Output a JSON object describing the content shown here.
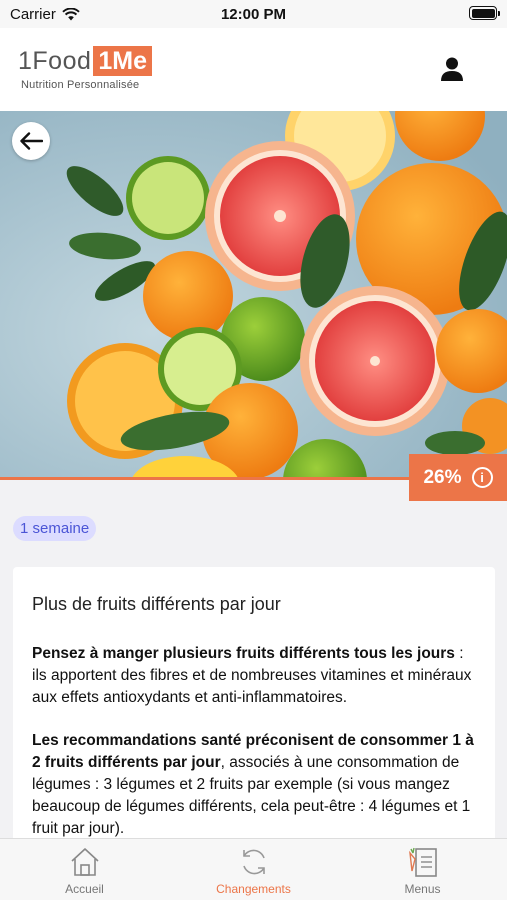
{
  "status_bar": {
    "carrier": "Carrier",
    "time": "12:00 PM"
  },
  "header": {
    "logo_part1": "1Food",
    "logo_part2": "1Me",
    "tagline": "Nutrition Personnalisée"
  },
  "progress": {
    "label": "26%",
    "info_icon": "i"
  },
  "duration": "1 semaine",
  "card": {
    "title": "Plus de fruits différents par jour",
    "para1_bold": "Pensez à manger plusieurs fruits différents tous les jours",
    "para1_rest": " : ils apportent des fibres et de nombreuses vitamines et minéraux aux effets antioxydants et anti-inflammatoires.",
    "para2_bold": "Les recommandations santé préconisent de consommer 1 à 2 fruits différents par jour",
    "para2_rest": ", associés à une consommation de légumes : 3 légumes et 2 fruits par exemple (si vous mangez beaucoup de légumes différents, cela peut-être : 4 légumes et 1 fruit par jour)."
  },
  "tabs": [
    {
      "label": "Accueil",
      "icon": "home-icon"
    },
    {
      "label": "Changements",
      "icon": "refresh-icon"
    },
    {
      "label": "Menus",
      "icon": "menu-list-icon"
    }
  ],
  "colors": {
    "accent": "#ec7548",
    "pill_bg": "#dcdcff",
    "pill_text": "#4b55d6"
  }
}
